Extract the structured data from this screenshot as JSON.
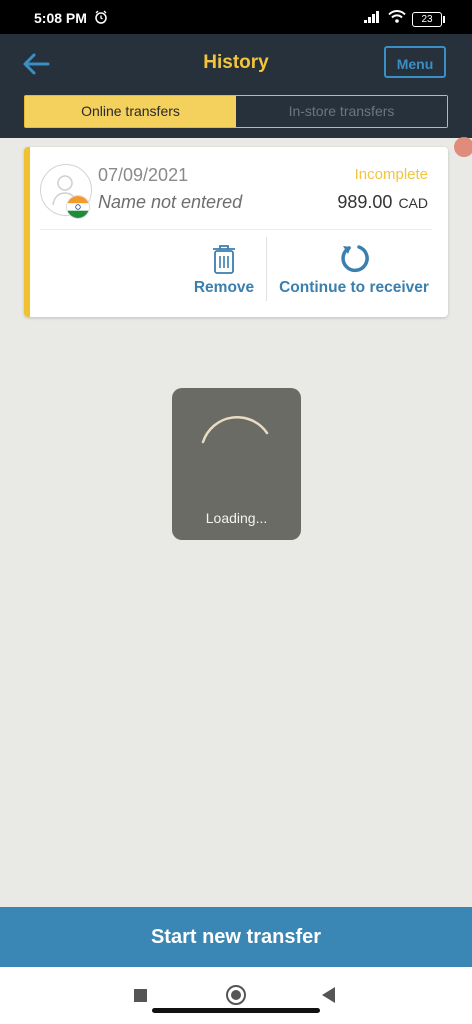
{
  "status_bar": {
    "time": "5:08 PM",
    "battery": "23"
  },
  "header": {
    "title": "History",
    "menu_label": "Menu"
  },
  "tabs": [
    {
      "label": "Online transfers",
      "active": true
    },
    {
      "label": "In-store transfers",
      "active": false
    }
  ],
  "transfer": {
    "date": "07/09/2021",
    "name": "Name not entered",
    "status": "Incomplete",
    "amount": "989.00",
    "currency": "CAD",
    "country_flag": "india-flag",
    "actions": {
      "remove": "Remove",
      "continue": "Continue to receiver"
    }
  },
  "loading": {
    "text": "Loading..."
  },
  "footer": {
    "start_button": "Start new transfer"
  },
  "colors": {
    "header_bg": "#26313b",
    "accent_yellow": "#f2c53d",
    "primary_blue": "#3a86b4"
  }
}
